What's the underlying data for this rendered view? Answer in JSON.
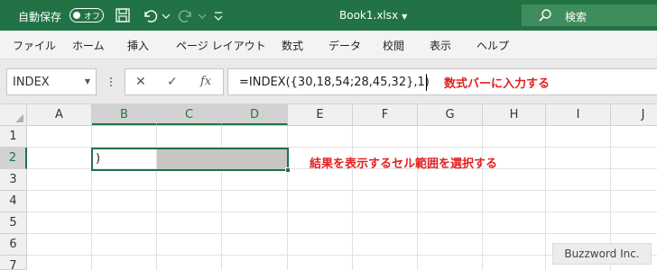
{
  "titlebar": {
    "autosave_label": "自動保存",
    "autosave_state": "オフ",
    "document_title": "Book1.xlsx",
    "search_placeholder": "検索",
    "bg_color": "#217346"
  },
  "ribbon_tabs": [
    "ファイル",
    "ホーム",
    "挿入",
    "ページ レイアウト",
    "数式",
    "データ",
    "校閲",
    "表示",
    "ヘルプ"
  ],
  "formula_bar": {
    "name_box": "INDEX",
    "fx_label": "fx",
    "formula": "=INDEX({30,18,54;28,45,32},1)",
    "annotation": "数式バーに入力する"
  },
  "grid": {
    "corner": "",
    "columns": [
      "A",
      "B",
      "C",
      "D",
      "E",
      "F",
      "G",
      "H",
      "I",
      "J"
    ],
    "rows": [
      "1",
      "2",
      "3",
      "4",
      "5",
      "6",
      "7"
    ],
    "selected_columns": [
      "B",
      "C",
      "D"
    ],
    "selected_row": "2",
    "active_cell_content": ")",
    "annotation": "結果を表示するセル範囲を選択する"
  },
  "credit": "Buzzword Inc.",
  "colors": {
    "accent": "#217346",
    "annotation": "#e02020",
    "selection_fill": "#c6c6c6"
  }
}
